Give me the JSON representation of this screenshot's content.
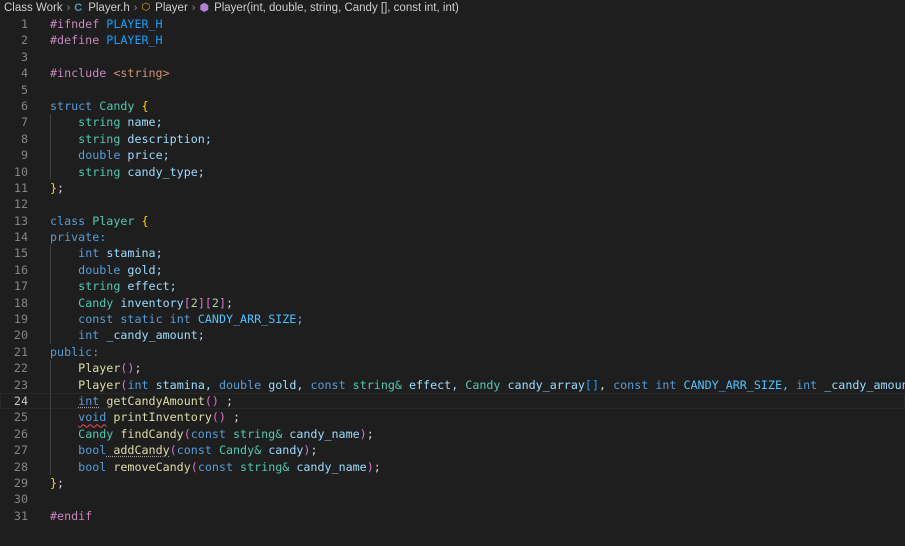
{
  "breadcrumb": {
    "folder": "Class Work",
    "file": "Player.h",
    "symbol": "Player",
    "member": "Player(int, double, string, Candy [], const int, int)"
  },
  "editor": {
    "current_line": 24,
    "lines": [
      [
        [
          "#ifndef",
          "ctrl"
        ],
        [
          " PLAYER_H",
          "br3"
        ]
      ],
      [
        [
          "#define",
          "ctrl"
        ],
        [
          " PLAYER_H",
          "br3"
        ]
      ],
      [],
      [
        [
          "#include",
          "ctrl"
        ],
        [
          " <string>",
          "str"
        ]
      ],
      [],
      [
        [
          "struct",
          "kw"
        ],
        [
          " ",
          "plain"
        ],
        [
          "Candy",
          "type"
        ],
        [
          " {",
          "br1"
        ]
      ],
      [
        [
          "    ",
          "plain"
        ],
        [
          "string",
          "type"
        ],
        [
          " name;",
          "var"
        ]
      ],
      [
        [
          "    ",
          "plain"
        ],
        [
          "string",
          "type"
        ],
        [
          " description;",
          "var"
        ]
      ],
      [
        [
          "    ",
          "plain"
        ],
        [
          "double",
          "kw"
        ],
        [
          " price;",
          "var"
        ]
      ],
      [
        [
          "    ",
          "plain"
        ],
        [
          "string",
          "type"
        ],
        [
          " candy_type;",
          "var"
        ]
      ],
      [
        [
          "}",
          "br1"
        ],
        [
          ";",
          "plain"
        ]
      ],
      [],
      [
        [
          "class",
          "kw"
        ],
        [
          " ",
          "plain"
        ],
        [
          "Player",
          "type"
        ],
        [
          " {",
          "br1"
        ]
      ],
      [
        [
          "private:",
          "kw"
        ]
      ],
      [
        [
          "    ",
          "plain"
        ],
        [
          "int",
          "kw"
        ],
        [
          " stamina;",
          "var"
        ]
      ],
      [
        [
          "    ",
          "plain"
        ],
        [
          "double",
          "kw"
        ],
        [
          " gold;",
          "var"
        ]
      ],
      [
        [
          "    ",
          "plain"
        ],
        [
          "string",
          "type"
        ],
        [
          " effect;",
          "var"
        ]
      ],
      [
        [
          "    ",
          "plain"
        ],
        [
          "Candy",
          "type"
        ],
        [
          " inventory",
          "var"
        ],
        [
          "[",
          "br2"
        ],
        [
          "2",
          "num"
        ],
        [
          "][",
          "br2"
        ],
        [
          "2",
          "num"
        ],
        [
          "]",
          "br2"
        ],
        [
          ";",
          "plain"
        ]
      ],
      [
        [
          "    ",
          "plain"
        ],
        [
          "const",
          "kw"
        ],
        [
          " ",
          "plain"
        ],
        [
          "static",
          "kw"
        ],
        [
          " ",
          "plain"
        ],
        [
          "int",
          "kw"
        ],
        [
          " CANDY_ARR_SIZE;",
          "const"
        ]
      ],
      [
        [
          "    ",
          "plain"
        ],
        [
          "int",
          "kw"
        ],
        [
          " _candy_amount;",
          "var"
        ]
      ],
      [
        [
          "public:",
          "kw"
        ]
      ],
      [
        [
          "    ",
          "plain"
        ],
        [
          "Player",
          "fn"
        ],
        [
          "()",
          "br2"
        ],
        [
          ";",
          "plain"
        ]
      ],
      [
        [
          "    ",
          "plain"
        ],
        [
          "Player",
          "fn"
        ],
        [
          "(",
          "br2"
        ],
        [
          "int",
          "kw"
        ],
        [
          " stamina, ",
          "var"
        ],
        [
          "double",
          "kw"
        ],
        [
          " gold, ",
          "var"
        ],
        [
          "const",
          "kw"
        ],
        [
          " ",
          "plain"
        ],
        [
          "string&",
          "type"
        ],
        [
          " effect, ",
          "var"
        ],
        [
          "Candy",
          "type"
        ],
        [
          " candy_array",
          "var"
        ],
        [
          "[]",
          "br3"
        ],
        [
          ", ",
          "plain"
        ],
        [
          "const",
          "kw"
        ],
        [
          " ",
          "plain"
        ],
        [
          "int",
          "kw"
        ],
        [
          " CANDY_ARR_SIZE, ",
          "const"
        ],
        [
          "int",
          "kw"
        ],
        [
          " _candy_amount",
          "var"
        ],
        [
          ")",
          "br2"
        ],
        [
          ";",
          "plain"
        ]
      ],
      [
        [
          "    ",
          "plain"
        ],
        [
          "int",
          "kw"
        ],
        [
          " getCandyAmount",
          "fn"
        ],
        [
          "()",
          "br2"
        ],
        [
          " ;",
          "plain"
        ]
      ],
      [
        [
          "    ",
          "plain"
        ],
        [
          "void",
          "kw"
        ],
        [
          " printInventory",
          "fn"
        ],
        [
          "()",
          "br2"
        ],
        [
          " ;",
          "plain"
        ]
      ],
      [
        [
          "    ",
          "plain"
        ],
        [
          "Candy",
          "type"
        ],
        [
          " findCandy",
          "fn"
        ],
        [
          "(",
          "br2"
        ],
        [
          "const",
          "kw"
        ],
        [
          " ",
          "plain"
        ],
        [
          "string&",
          "type"
        ],
        [
          " candy_name",
          "var"
        ],
        [
          ")",
          "br2"
        ],
        [
          ";",
          "plain"
        ]
      ],
      [
        [
          "    ",
          "plain"
        ],
        [
          "bool",
          "kw"
        ],
        [
          " addCandy",
          "fn"
        ],
        [
          "(",
          "br2"
        ],
        [
          "const",
          "kw"
        ],
        [
          " ",
          "plain"
        ],
        [
          "Candy&",
          "type"
        ],
        [
          " candy",
          "var"
        ],
        [
          ")",
          "br2"
        ],
        [
          ";",
          "plain"
        ]
      ],
      [
        [
          "    ",
          "plain"
        ],
        [
          "bool",
          "kw"
        ],
        [
          " removeCandy",
          "fn"
        ],
        [
          "(",
          "br2"
        ],
        [
          "const",
          "kw"
        ],
        [
          " ",
          "plain"
        ],
        [
          "string&",
          "type"
        ],
        [
          " candy_name",
          "var"
        ],
        [
          ")",
          "br2"
        ],
        [
          ";",
          "plain"
        ]
      ],
      [
        [
          "}",
          "br1"
        ],
        [
          ";",
          "plain"
        ]
      ],
      [],
      [
        [
          "#endif",
          "ctrl"
        ]
      ]
    ]
  }
}
